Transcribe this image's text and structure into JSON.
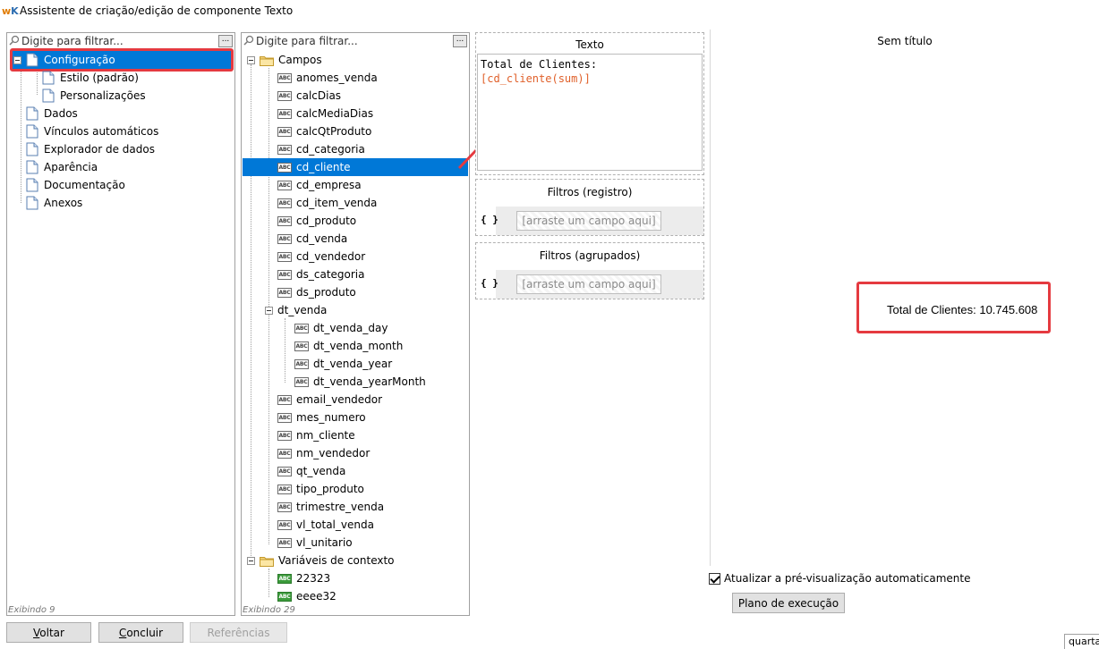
{
  "window": {
    "logo": "wK",
    "title": "Assistente de criação/edição de componente Texto"
  },
  "left_panel": {
    "filter_placeholder": "Digite para filtrar...",
    "more_label": "...",
    "items": [
      {
        "label": "Configuração",
        "selected": true,
        "expanded": true
      },
      {
        "label": "Estilo (padrão)"
      },
      {
        "label": "Personalizações"
      },
      {
        "label": "Dados"
      },
      {
        "label": "Vínculos automáticos"
      },
      {
        "label": "Explorador de dados"
      },
      {
        "label": "Aparência"
      },
      {
        "label": "Documentação"
      },
      {
        "label": "Anexos"
      }
    ],
    "footer": "Exibindo 9"
  },
  "fields_panel": {
    "filter_placeholder": "Digite para filtrar...",
    "more_label": "...",
    "field_icon_text": "ABC",
    "campos_label": "Campos",
    "fields": [
      "anomes_venda",
      "calcDias",
      "calcMediaDias",
      "calcQtProduto",
      "cd_categoria",
      "cd_cliente",
      "cd_empresa",
      "cd_item_venda",
      "cd_produto",
      "cd_venda",
      "cd_vendedor",
      "ds_categoria",
      "ds_produto"
    ],
    "selected_field": "cd_cliente",
    "dt_venda_label": "dt_venda",
    "dt_venda_children": [
      "dt_venda_day",
      "dt_venda_month",
      "dt_venda_year",
      "dt_venda_yearMonth"
    ],
    "fields_after": [
      "email_vendedor",
      "mes_numero",
      "nm_cliente",
      "nm_vendedor",
      "qt_venda",
      "tipo_produto",
      "trimestre_venda",
      "vl_total_venda",
      "vl_unitario"
    ],
    "context_label": "Variáveis de contexto",
    "context_vars": [
      "22323",
      "eeee32"
    ],
    "footer": "Exibindo 29"
  },
  "text_section": {
    "title": "Texto",
    "line1": "Total de Clientes:",
    "line2": "[cd_cliente(sum)]"
  },
  "filters_record": {
    "title": "Filtros (registro)",
    "braces": "{ }",
    "drop_placeholder": "[arraste um campo aqui]"
  },
  "filters_grouped": {
    "title": "Filtros (agrupados)",
    "braces": "{ }",
    "drop_placeholder": "[arraste um campo aqui]"
  },
  "preview": {
    "title": "Sem título",
    "text": "Total de Clientes: 10.745.608"
  },
  "auto_preview": {
    "label": "Atualizar a pré-visualização automaticamente",
    "checked": true
  },
  "buttons": {
    "plan": "Plano de execução",
    "back_u": "V",
    "back_rest": "oltar",
    "finish_u": "C",
    "finish_rest": "oncluir",
    "references": "Referências"
  },
  "status_corner": "quarta",
  "colors": {
    "selection": "#0078d7",
    "highlight_red": "#e53a40",
    "expression": "#e0602a"
  }
}
